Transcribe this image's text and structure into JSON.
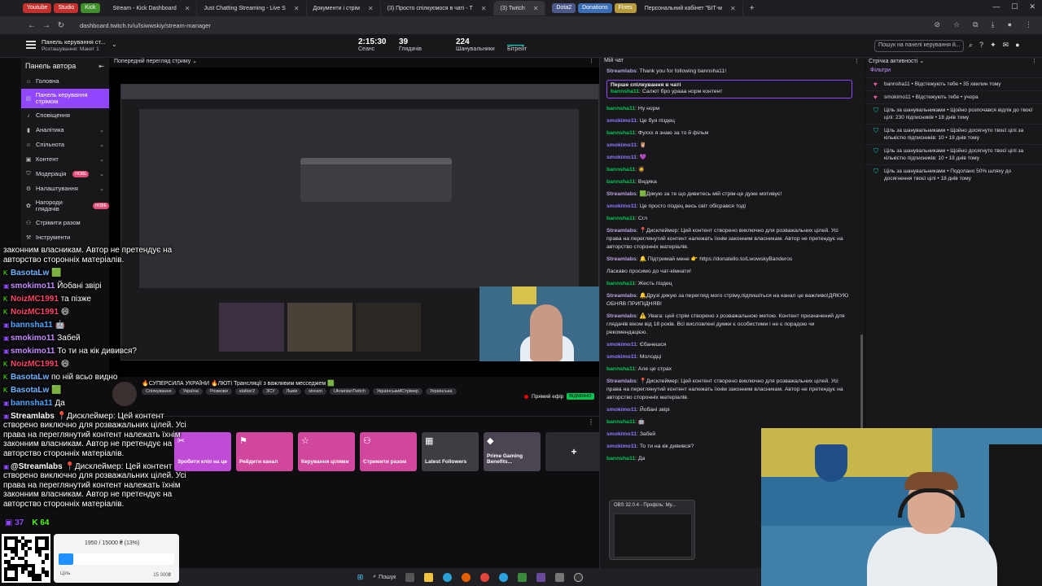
{
  "browser": {
    "tab_pills": [
      {
        "label": "Youtube",
        "color": "#c4302b"
      },
      {
        "label": "Studio",
        "color": "#c4302b"
      },
      {
        "label": "Kick",
        "color": "#3f8f2a"
      }
    ],
    "tabs": [
      {
        "label": "Stream - Kick Dashboard",
        "active": false
      },
      {
        "label": "Just Chatting Streaming - Live S",
        "active": false
      },
      {
        "label": "Документи і стрім",
        "active": false
      },
      {
        "label": "(3) Просто спілкуємося в чаті - Т",
        "active": false
      },
      {
        "label": "(3) Twitch",
        "active": true
      }
    ],
    "tab_pills_right": [
      {
        "label": "Dota2",
        "color": "#4c5a8a"
      },
      {
        "label": "Donations",
        "color": "#3b6fb5"
      },
      {
        "label": "Fines",
        "color": "#b59b3b"
      }
    ],
    "extra_tab": "Персональний кабінет \"БІТ-м",
    "url": "dashboard.twitch.tv/u/lsiwwskiy/stream-manager"
  },
  "header": {
    "title": "Панель керування ст...",
    "subtitle": "Розташування: Макет 1",
    "stats": [
      {
        "value": "2:15:30",
        "label": "Сеанс"
      },
      {
        "value": "39",
        "label": "Глядачів"
      },
      {
        "value": "224",
        "label": "Шанувальники"
      },
      {
        "value": "",
        "label": "Бітрейт"
      }
    ],
    "search_placeholder": "Пошук на панелі керування й..."
  },
  "sidebar": {
    "title": "Панель автора",
    "items": [
      {
        "label": "Головна",
        "icon": "home-icon",
        "chevron": false,
        "badge": ""
      },
      {
        "label": "Панель керування стрімом",
        "icon": "dashboard-icon",
        "chevron": false,
        "badge": "",
        "active": true
      },
      {
        "label": "Сповіщення",
        "icon": "bell-icon",
        "chevron": false,
        "badge": ""
      },
      {
        "label": "Аналітика",
        "icon": "analytics-icon",
        "chevron": true,
        "badge": ""
      },
      {
        "label": "Спільнота",
        "icon": "community-icon",
        "chevron": true,
        "badge": ""
      },
      {
        "label": "Контент",
        "icon": "content-icon",
        "chevron": true,
        "badge": ""
      },
      {
        "label": "Модерація",
        "icon": "shield-icon",
        "chevron": true,
        "badge": "НОВЕ"
      },
      {
        "label": "Налаштування",
        "icon": "gear-icon",
        "chevron": true,
        "badge": ""
      },
      {
        "label": "Нагороди глядачів",
        "icon": "gift-icon",
        "chevron": true,
        "badge": "НОВЕ"
      },
      {
        "label": "Стрімити разом",
        "icon": "together-icon",
        "chevron": false,
        "badge": ""
      },
      {
        "label": "Інструменти",
        "icon": "tools-icon",
        "chevron": false,
        "badge": ""
      }
    ]
  },
  "preview": {
    "header": "Попередній перегляд стриму"
  },
  "stream_info": {
    "title": "🔥СУПЕРСИЛА УКРАЇНИ 🔥ЛЮТІ Трансляції з важливим месседжем 🟩",
    "tags": [
      "Спілкування",
      "Україна",
      "Розмови",
      "stalker2",
      "ЗСУ",
      "Львів",
      "stream",
      "UkrainianTwitch",
      "УкраїнськийСтрімер",
      "Українська"
    ],
    "live_label": "Прямий ефір",
    "live_badge": "ВІДМІННО"
  },
  "quick_actions": [
    {
      "label": "Зробити кліп на це",
      "glyph": "✂",
      "style": "qa-purple"
    },
    {
      "label": "Рейдити канал",
      "glyph": "⚑",
      "style": "qa-pink"
    },
    {
      "label": "Керування цілями",
      "glyph": "☆",
      "style": "qa-pink"
    },
    {
      "label": "Стримити разом",
      "glyph": "⚇",
      "style": "qa-pink"
    },
    {
      "label": "Latest Followers",
      "glyph": "▦",
      "style": "qa-gray"
    },
    {
      "label": "Prime Gaming Benefits...",
      "glyph": "◆",
      "style": "qa-gray2"
    }
  ],
  "chat": {
    "header": "Мій чат",
    "pinned_title": "Перше спілкування в чаті",
    "pinned_msg": {
      "user": "bannsha11",
      "text": "Салют бро урааа норм контент",
      "color": "#00c853"
    },
    "messages": [
      {
        "user": "Streamlabs",
        "text": "Thank you for following bannsha11!",
        "color": "#b9a3e3"
      },
      {
        "user": "bannsha11",
        "text": "Ну норм",
        "color": "#00c853"
      },
      {
        "user": "smokimo11",
        "text": "Це буя піздец",
        "color": "#8a7cff"
      },
      {
        "user": "bannsha11",
        "text": "Фуххх я знаю за то й фільм",
        "color": "#00c853"
      },
      {
        "user": "smokimo11",
        "text": "🦉",
        "color": "#8a7cff"
      },
      {
        "user": "smokimo11",
        "text": "💜",
        "color": "#8a7cff"
      },
      {
        "user": "bannsha11",
        "text": "🧔",
        "color": "#00c853"
      },
      {
        "user": "bannsha11",
        "text": "Вндяка",
        "color": "#00c853"
      },
      {
        "user": "Streamlabs",
        "text": "🟩Дякую за те що дивитесь мій стрім-це дуже мотивує!",
        "color": "#b9a3e3"
      },
      {
        "user": "smokimo11",
        "text": "Це просто піздец весь світ обісрався тоді",
        "color": "#8a7cff"
      },
      {
        "user": "bannsha11",
        "text": "Сгл",
        "color": "#00c853"
      },
      {
        "user": "Streamlabs",
        "text": "📍Дисклеймер: Цей контент створено виключно для розважальних цілей. Усі права на переглянутий контент належать їхнім законним власникам. Автор не претендує на авторство сторонніх матеріалів.",
        "color": "#b9a3e3"
      },
      {
        "user": "Streamlabs",
        "text": "🔔 Підтримай мене 👉 https://donatello.to/LwowskyBanderos",
        "color": "#b9a3e3"
      },
      {
        "user": "",
        "text": "Ласкаво просимо до чат-кімнати!",
        "color": "#dedee3"
      },
      {
        "user": "bannsha11",
        "text": "Жесть піздец",
        "color": "#00c853"
      },
      {
        "user": "Streamlabs",
        "text": "🔔Друзі дякую за перегляд мого стріму,підпишіться на канал це важливо!ДЯКУЮ ОБНЯВ ПРИПІДНЯВ!",
        "color": "#b9a3e3"
      },
      {
        "user": "Streamlabs",
        "text": "⚠️ Увага: цей стрім створено з розважальною метою. Контент призначений для глядачів віком від 18 років. Всі висловлені думки є особистими і не є порадою чи рекомендацією.",
        "color": "#b9a3e3"
      },
      {
        "user": "smokimo11",
        "text": "Єбанешся",
        "color": "#8a7cff"
      },
      {
        "user": "smokimo11",
        "text": "Молодці",
        "color": "#8a7cff"
      },
      {
        "user": "bannsha11",
        "text": "Але це страх",
        "color": "#00c853"
      },
      {
        "user": "Streamlabs",
        "text": "📍Дисклеймер: Цей контент створено виключно для розважальних цілей. Усі права на переглянутий контент належать їхнім законним власникам. Автор не претендує на авторство сторонніх матеріалів.",
        "color": "#b9a3e3"
      },
      {
        "user": "smokimo11",
        "text": "Йобані звірі",
        "color": "#8a7cff"
      },
      {
        "user": "bannsha11",
        "text": "🤖",
        "color": "#00c853"
      },
      {
        "user": "smokimo11",
        "text": "Забей",
        "color": "#8a7cff"
      },
      {
        "user": "smokimo11",
        "text": "То ти на кік дивився?",
        "color": "#8a7cff"
      },
      {
        "user": "bannsha11",
        "text": "Да",
        "color": "#00c853"
      }
    ]
  },
  "activity": {
    "header": "Стрічка активності",
    "filter": "Фільтри",
    "items": [
      {
        "icon": "heart-icon",
        "kind": "heart",
        "text": "bannsha11 • Відстежують тебе • 35 хвилин тому"
      },
      {
        "icon": "heart-icon",
        "kind": "heart",
        "text": "smokimo11 • Відстежують тебе • учора"
      },
      {
        "icon": "goal-icon",
        "kind": "goal",
        "text": "Ціль за шанувальниками • Щойно розпочався відлік до твоєї цілі: 230 підписників • 18 днів тому"
      },
      {
        "icon": "goal-icon",
        "kind": "goal",
        "text": "Ціль за шанувальниками • Щойно досягнуто твоєї цілі за кількістю підписників: 10 • 18 днів тому"
      },
      {
        "icon": "goal-icon",
        "kind": "goal",
        "text": "Ціль за шанувальниками • Щойно досягнуто твоєї цілі за кількістю підписників: 10 • 18 днів тому"
      },
      {
        "icon": "goal-icon",
        "kind": "goal",
        "text": "Ціль за шанувальниками • Подолано 50% шляху до досягнення твоєї цілі • 18 днів тому"
      }
    ]
  },
  "overlay_chat": {
    "messages": [
      {
        "user": "",
        "text": "законним власникам. Автор не претендує на авторство сторонніх матеріалів.",
        "color": "#ffffff",
        "icon": ""
      },
      {
        "user": "BasotaLw",
        "text": "🟩",
        "color": "#6fb2ff",
        "icon": "K"
      },
      {
        "user": "smokimo11",
        "text": "Йобані звірі",
        "color": "#c58cff",
        "icon": "tw"
      },
      {
        "user": "NoizMC1991",
        "text": "та пізже",
        "color": "#ff4466",
        "icon": "K"
      },
      {
        "user": "NoizMC1991",
        "text": "😄",
        "color": "#ff4466",
        "icon": "K"
      },
      {
        "user": "bannsha11",
        "text": "🤖",
        "color": "#4ea6ff",
        "icon": "tw"
      },
      {
        "user": "smokimo11",
        "text": "Забей",
        "color": "#c58cff",
        "icon": "tw"
      },
      {
        "user": "smokimo11",
        "text": "То ти на кік дивився?",
        "color": "#c58cff",
        "icon": "tw"
      },
      {
        "user": "NoizMC1991",
        "text": "😄",
        "color": "#ff4466",
        "icon": "K"
      },
      {
        "user": "BasotaLw",
        "text": "по ній всьо видно",
        "color": "#6fb2ff",
        "icon": "K"
      },
      {
        "user": "BasotaLw",
        "text": "🟩",
        "color": "#6fb2ff",
        "icon": "K"
      },
      {
        "user": "bannsha11",
        "text": "Да",
        "color": "#4ea6ff",
        "icon": "tw"
      },
      {
        "user": "Streamlabs",
        "text": "📍Дисклеймер: Цей контент створено виключно для розважальних цілей. Усі права на переглянутий контент належать їхнім законним власникам. Автор не претендує на авторство сторонніх матеріалів.",
        "color": "#ffffff",
        "icon": "tw"
      },
      {
        "user": "@Streamlabs",
        "text": "📍Дисклеймер: Цей контент створено виключно для розважальних цілей. Усі права на переглянутий контент належать їхнім законним власникам. Автор не претендує на авторство сторонніх матеріалів.",
        "color": "#ffffff",
        "icon": "tw"
      }
    ],
    "twitch_viewers": "37",
    "kick_viewers": "64"
  },
  "donation": {
    "text": "1950 / 15000 ₴ (13%)",
    "progress": 0.13,
    "min": "Ціль",
    "max": "15 000₴"
  },
  "obs_popup": {
    "title": "OBS 32.0.4 - Профіль: My..."
  },
  "taskbar": {
    "search_label": "Пошук"
  }
}
